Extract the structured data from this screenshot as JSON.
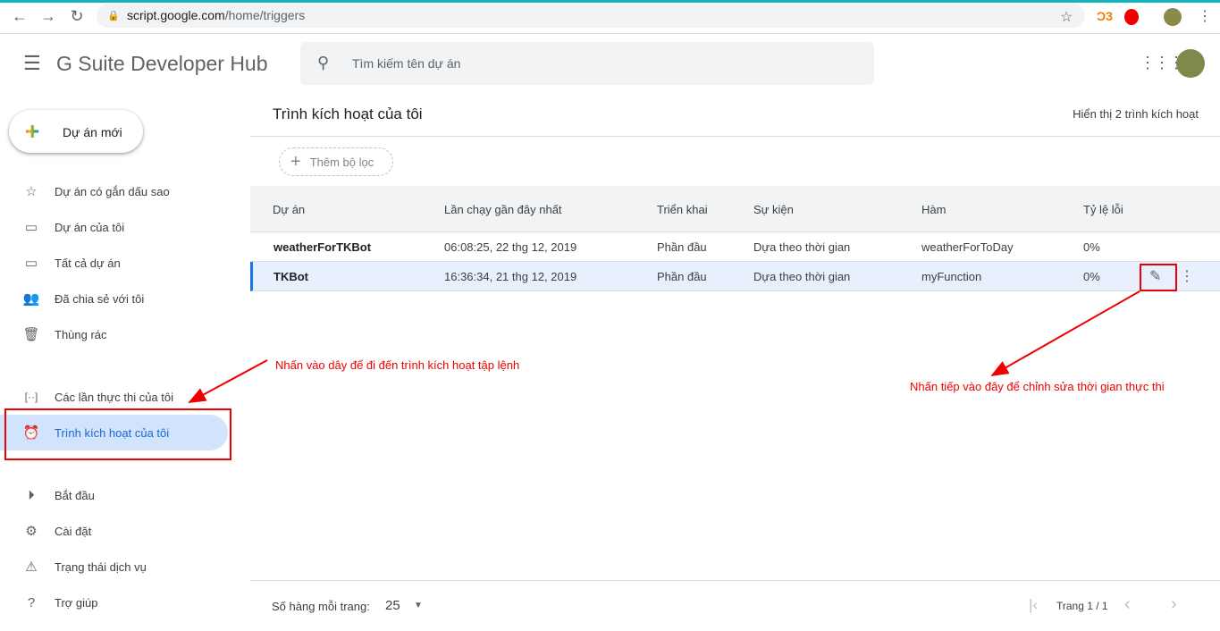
{
  "browser": {
    "url_host": "script.google.com",
    "url_path": "/home/triggers"
  },
  "app": {
    "title": "G Suite Developer Hub",
    "search_placeholder": "Tìm kiếm tên dự án"
  },
  "sidebar": {
    "new_project": "Dự án mới",
    "items": [
      {
        "label": "Dự án có gắn dấu sao",
        "icon": "star-icon"
      },
      {
        "label": "Dự án của tôi",
        "icon": "folder-icon"
      },
      {
        "label": "Tất cả dự án",
        "icon": "folder-icon"
      },
      {
        "label": "Đã chia sẻ với tôi",
        "icon": "people-icon"
      },
      {
        "label": "Thùng rác",
        "icon": "trash-icon"
      },
      {
        "label": "Các lần thực thi của tôi",
        "icon": "executions-icon"
      },
      {
        "label": "Trình kích hoạt của tôi",
        "icon": "alarm-icon"
      },
      {
        "label": "Bắt đầu",
        "icon": "play-icon"
      },
      {
        "label": "Cài đặt",
        "icon": "gear-icon"
      },
      {
        "label": "Trạng thái dịch vụ",
        "icon": "warning-icon"
      },
      {
        "label": "Trợ giúp",
        "icon": "help-icon"
      }
    ]
  },
  "main": {
    "title": "Trình kích hoạt của tôi",
    "count": "Hiển thị 2 trình kích hoạt",
    "add_filter": "Thêm bộ lọc",
    "columns": [
      "Dự án",
      "Lần chạy gần đây nhất",
      "Triển khai",
      "Sự kiện",
      "Hàm",
      "Tỷ lệ lỗi"
    ],
    "rows": [
      [
        "weatherForTKBot",
        "06:08:25, 22 thg 12, 2019",
        "Phần đầu",
        "Dựa theo thời gian",
        "weatherForToDay",
        "0%"
      ],
      [
        "TKBot",
        "16:36:34, 21 thg 12, 2019",
        "Phần đầu",
        "Dựa theo thời gian",
        "myFunction",
        "0%"
      ]
    ]
  },
  "footer": {
    "rows_label": "Số hàng mỗi trang:",
    "rows_value": "25",
    "page": "Trang 1 / 1"
  },
  "annotations": {
    "left": "Nhấn vào dây để đi đến trình kích hoạt tập lệnh",
    "right": "Nhấn tiếp vào đây để chỉnh sửa thời gian thực thi"
  },
  "colors": {
    "annotation": "#ee0000",
    "accent": "#1967d2"
  }
}
